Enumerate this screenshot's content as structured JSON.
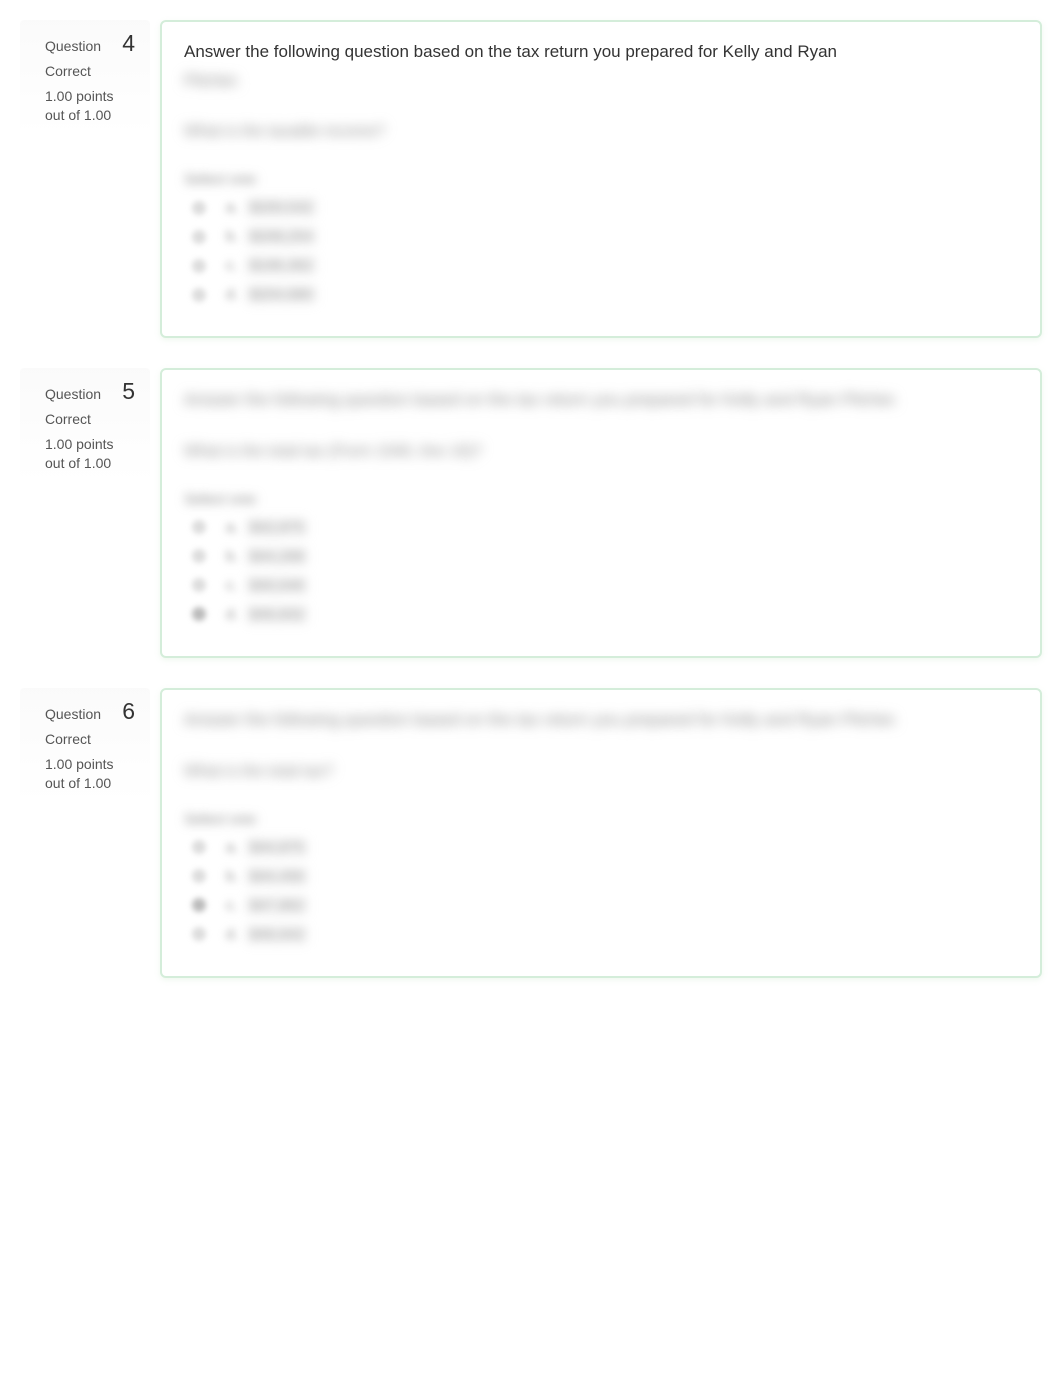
{
  "questions": [
    {
      "label": "Question",
      "number": "4",
      "status": "Correct",
      "points": "1.00 points out of 1.00",
      "text_visible": "Answer the following question based on the tax return you prepared for Kelly and Ryan",
      "text_blur": "Pitcher.",
      "sub_prompt": "What is the taxable income?",
      "select_label": "Select one:",
      "options": [
        {
          "letter": "a.",
          "value": "$200,542"
        },
        {
          "letter": "b.",
          "value": "$208,254"
        },
        {
          "letter": "c.",
          "value": "$196,362"
        },
        {
          "letter": "d.",
          "value": "$204,680"
        }
      ],
      "selected_index": -1
    },
    {
      "label": "Question",
      "number": "5",
      "status": "Correct",
      "points": "1.00 points out of 1.00",
      "text_visible": "",
      "text_blur": "Answer the following question based on the tax return you prepared for Kelly and Ryan Pitcher.",
      "sub_prompt": "What is the total tax (Form 1040, line 16)?",
      "select_label": "Select one:",
      "options": [
        {
          "letter": "a.",
          "value": "$42,875"
        },
        {
          "letter": "b.",
          "value": "$44,268"
        },
        {
          "letter": "c.",
          "value": "$40,646"
        },
        {
          "letter": "d.",
          "value": "$46,832"
        }
      ],
      "selected_index": 3
    },
    {
      "label": "Question",
      "number": "6",
      "status": "Correct",
      "points": "1.00 points out of 1.00",
      "text_visible": "",
      "text_blur": "Answer the following question based on the tax return you prepared for Kelly and Ryan Pitcher.",
      "sub_prompt": "What is the total tax?",
      "select_label": "Select one:",
      "options": [
        {
          "letter": "a.",
          "value": "$44,875"
        },
        {
          "letter": "b.",
          "value": "$44,456"
        },
        {
          "letter": "c.",
          "value": "$47,862"
        },
        {
          "letter": "d.",
          "value": "$46,642"
        }
      ],
      "selected_index": 2
    }
  ]
}
